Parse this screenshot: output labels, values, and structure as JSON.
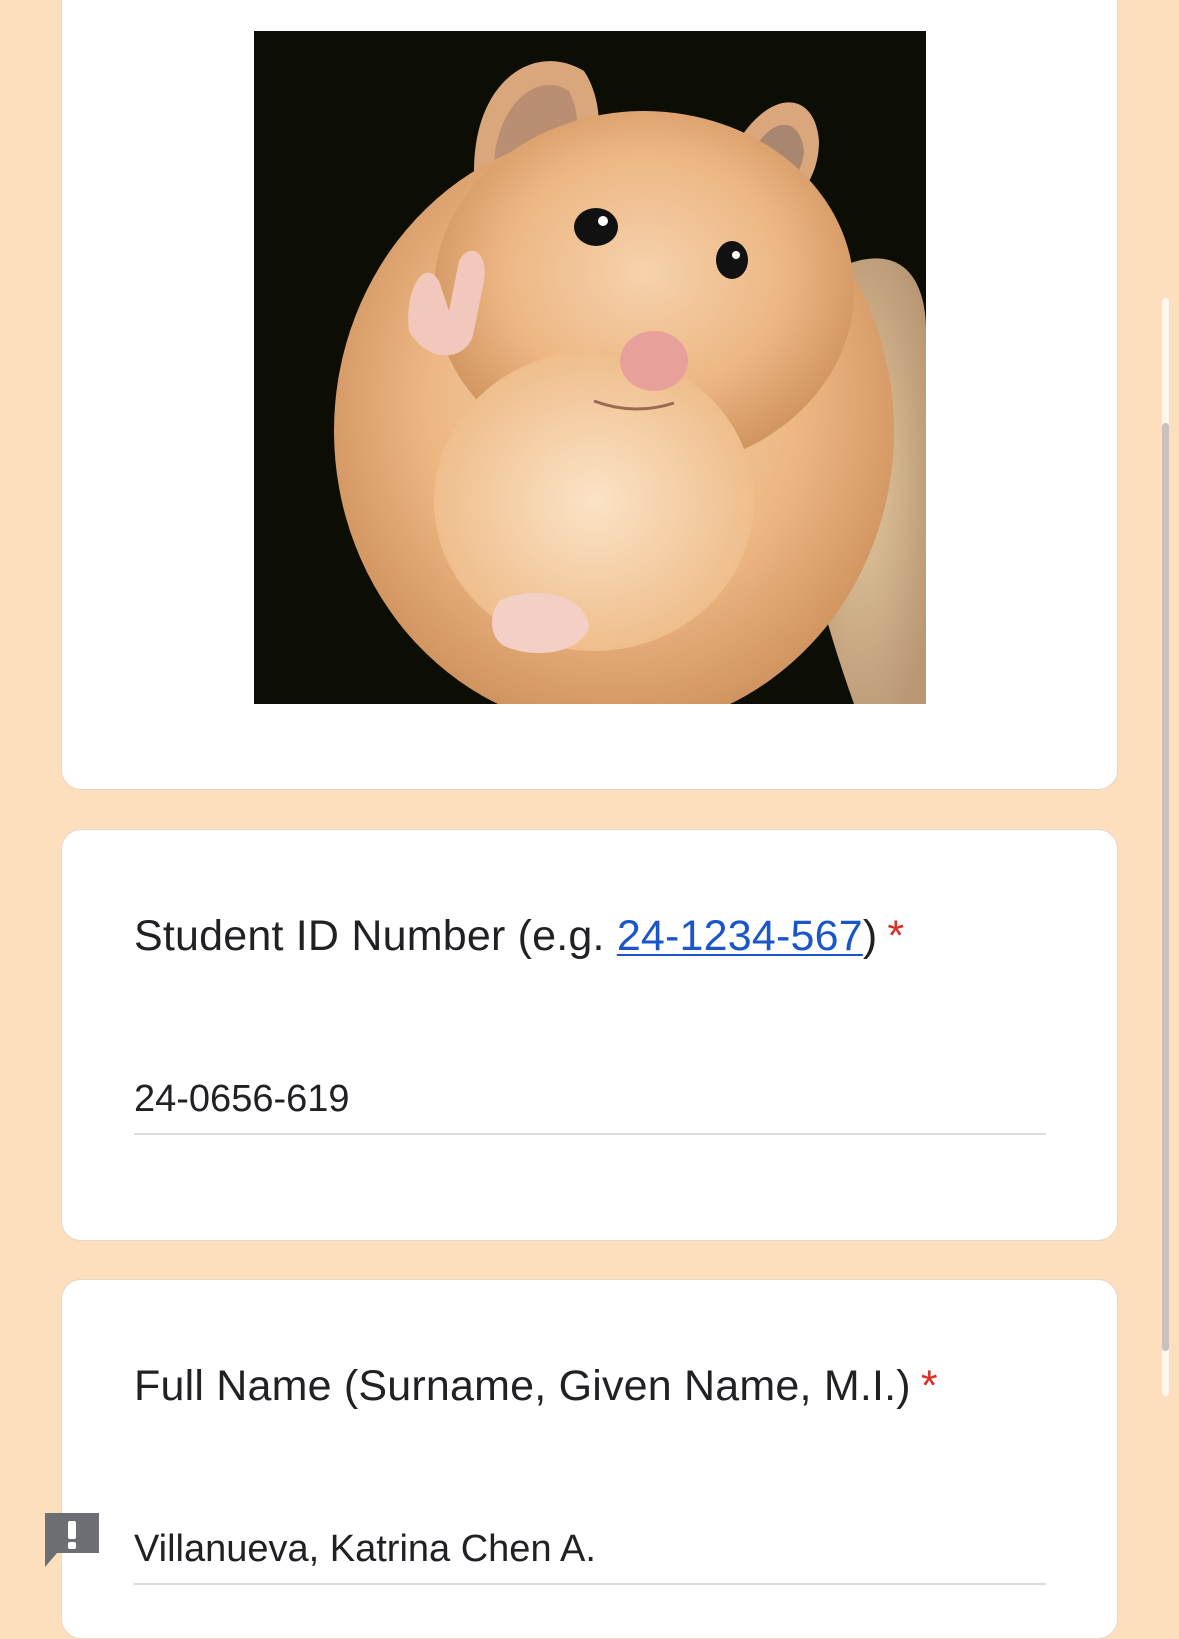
{
  "form": {
    "colors": {
      "background": "#FDDFBE",
      "card": "#FFFFFF",
      "link": "#1A55C9",
      "required": "#D93025"
    },
    "header_image": {
      "icon": "hamster-photo"
    },
    "questions": [
      {
        "label_prefix": "Student ID Number (e.g. ",
        "label_link": "24-1234-567",
        "label_suffix": ")",
        "required_mark": "*",
        "value": "24-0656-619"
      },
      {
        "label": "Full Name (Surname, Given Name, M.I.)",
        "required_mark": "*",
        "value": "Villanueva, Katrina Chen A."
      }
    ]
  },
  "report_button": {
    "icon": "report-icon"
  }
}
